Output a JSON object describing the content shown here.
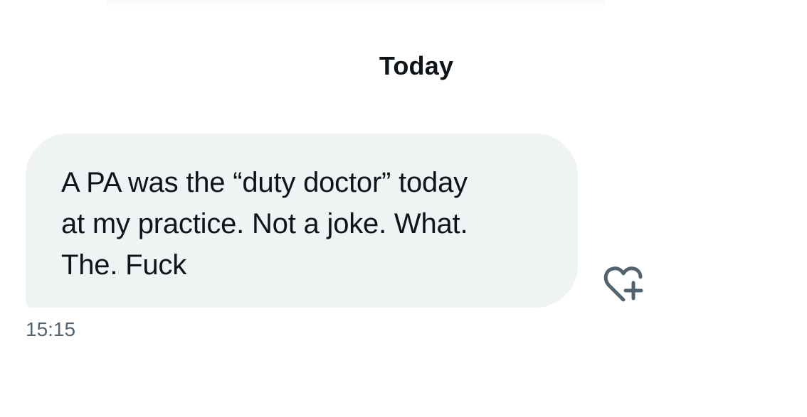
{
  "conversation": {
    "date_divider": "Today",
    "messages": [
      {
        "text": "A PA was the “duty doctor” today\nat my practice. Not a joke. What.\nThe. Fuck",
        "time": "15:15",
        "react_icon": "heart-plus-icon"
      }
    ]
  },
  "colors": {
    "bubble_bg": "#eff3f4",
    "text": "#0f1419",
    "secondary_text": "#536471"
  }
}
